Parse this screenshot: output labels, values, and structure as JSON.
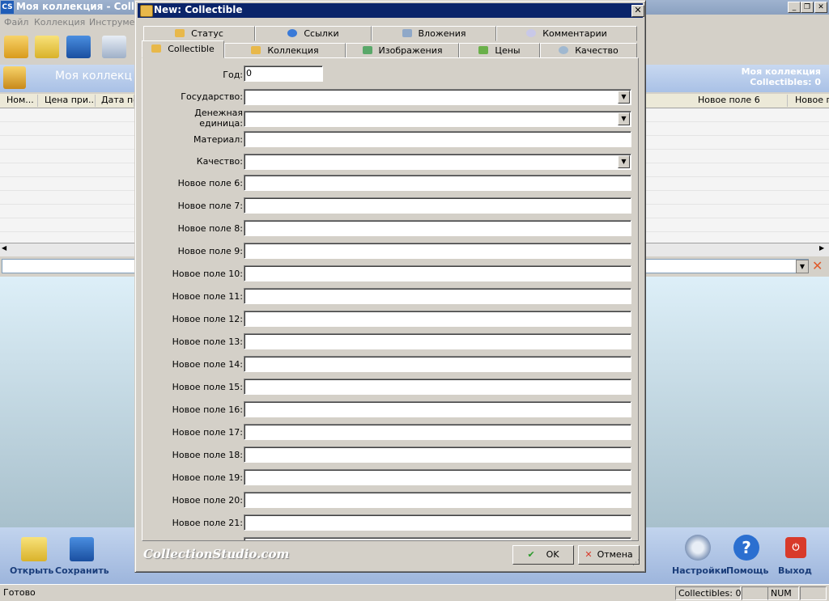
{
  "main_window": {
    "title": "Моя коллекция - Collectic",
    "menu": [
      "Файл",
      "Коллекция",
      "Инструмен"
    ],
    "banner": {
      "title": "Моя коллекц",
      "right_line1": "Моя коллекция",
      "right_line2": "Collectibles: 0"
    },
    "grid_columns_left": [
      "Ном...",
      "Цена при...",
      "Дата пок"
    ],
    "grid_columns_right": [
      "Новое поле 6",
      "Новое п"
    ],
    "bottom_buttons": {
      "open": "Открыть",
      "save": "Сохранить",
      "settings": "Настройки",
      "help": "Помощь",
      "exit": "Выход"
    },
    "status": {
      "left": "Готово",
      "count": "Collectibles: 0",
      "num": "NUM"
    }
  },
  "dialog": {
    "title": "New: Collectible",
    "tabs_top": [
      "Статус",
      "Ссылки",
      "Вложения",
      "Комментарии"
    ],
    "tabs_bottom": [
      "Collectible",
      "Коллекция",
      "Изображения",
      "Цены",
      "Качество"
    ],
    "fields": {
      "year_label": "Год:",
      "year_value": "0",
      "country_label": "Государство:",
      "currency_label_1": "Денежная",
      "currency_label_2": "единица:",
      "material_label": "Материал:",
      "quality_label": "Качество:",
      "new_fields": [
        "Новое поле 6:",
        "Новое поле 7:",
        "Новое поле 8:",
        "Новое поле 9:",
        "Новое поле 10:",
        "Новое поле 11:",
        "Новое поле 12:",
        "Новое поле 13:",
        "Новое поле 14:",
        "Новое поле 15:",
        "Новое поле 16:",
        "Новое поле 17:",
        "Новое поле 18:",
        "Новое поле 19:",
        "Новое поле 20:",
        "Новое поле 21:"
      ]
    },
    "brand": "CollectionStudio.com",
    "ok_label": "OK",
    "cancel_label": "Отмена"
  },
  "colors": {
    "title_active": "#0a246a",
    "banner": "#a9c1e6",
    "bottom_label": "#1a3d7a"
  }
}
